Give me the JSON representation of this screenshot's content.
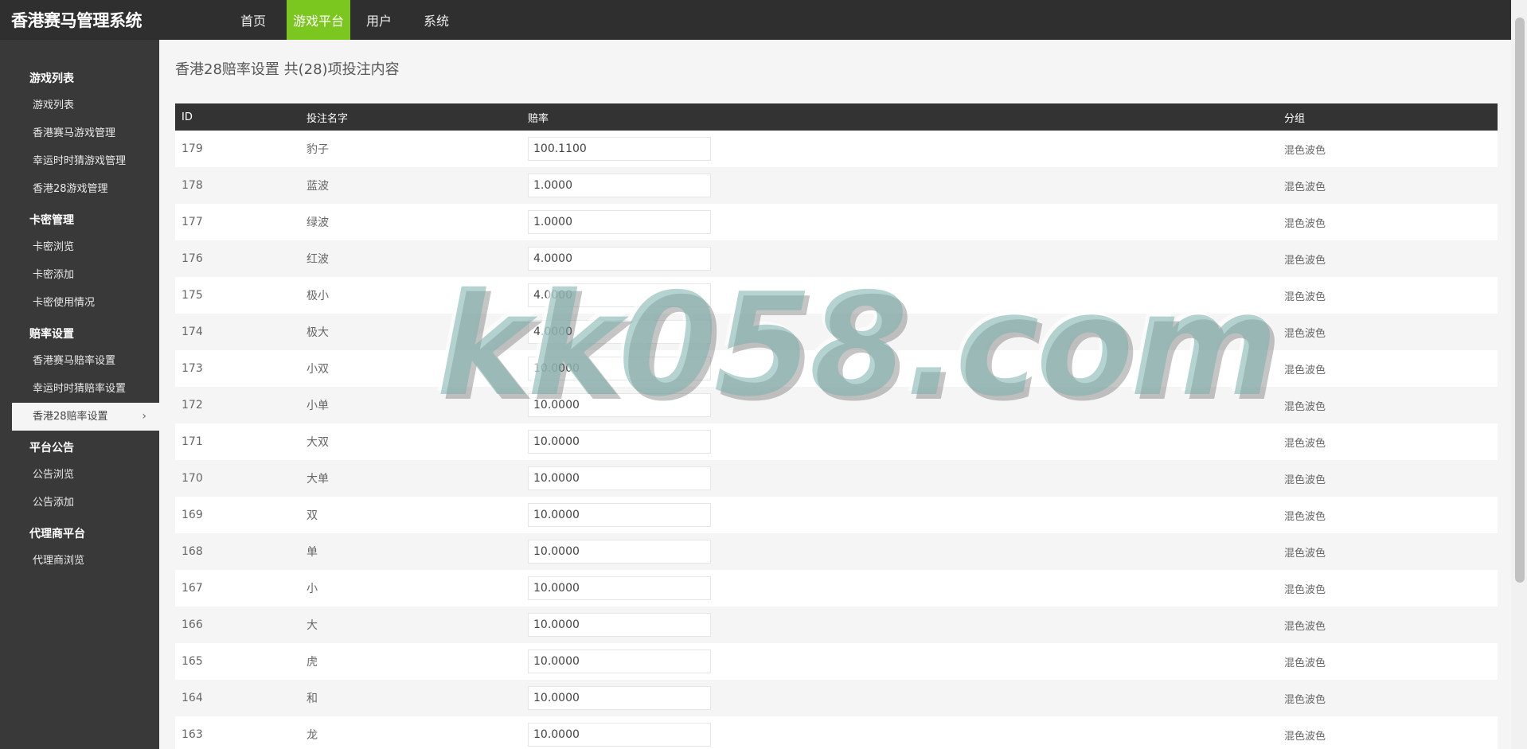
{
  "app": {
    "brand": "香港赛马管理系统"
  },
  "topnav": [
    {
      "label": "首页",
      "active": false
    },
    {
      "label": "游戏平台",
      "active": true
    },
    {
      "label": "用户",
      "active": false
    },
    {
      "label": "系统",
      "active": false
    }
  ],
  "sidebar": {
    "groups": [
      {
        "title": "游戏列表",
        "items": [
          "游戏列表",
          "香港赛马游戏管理",
          "幸运时时猜游戏管理",
          "香港28游戏管理"
        ]
      },
      {
        "title": "卡密管理",
        "items": [
          "卡密浏览",
          "卡密添加",
          "卡密使用情况"
        ]
      },
      {
        "title": "赔率设置",
        "items": [
          "香港赛马赔率设置",
          "幸运时时猜赔率设置",
          "香港28赔率设置"
        ]
      },
      {
        "title": "平台公告",
        "items": [
          "公告浏览",
          "公告添加"
        ]
      },
      {
        "title": "代理商平台",
        "items": [
          "代理商浏览"
        ]
      }
    ],
    "active_item": "香港28赔率设置"
  },
  "main": {
    "title": "香港28赔率设置 共(28)项投注内容",
    "columns": [
      "ID",
      "投注名字",
      "赔率",
      "分组"
    ],
    "rows": [
      {
        "id": "179",
        "name": "豹子",
        "odds": "100.1100",
        "group": "混色波色"
      },
      {
        "id": "178",
        "name": "蓝波",
        "odds": "1.0000",
        "group": "混色波色"
      },
      {
        "id": "177",
        "name": "绿波",
        "odds": "1.0000",
        "group": "混色波色"
      },
      {
        "id": "176",
        "name": "红波",
        "odds": "4.0000",
        "group": "混色波色"
      },
      {
        "id": "175",
        "name": "极小",
        "odds": "4.0000",
        "group": "混色波色"
      },
      {
        "id": "174",
        "name": "极大",
        "odds": "4.0000",
        "group": "混色波色"
      },
      {
        "id": "173",
        "name": "小双",
        "odds": "10.0000",
        "group": "混色波色"
      },
      {
        "id": "172",
        "name": "小单",
        "odds": "10.0000",
        "group": "混色波色"
      },
      {
        "id": "171",
        "name": "大双",
        "odds": "10.0000",
        "group": "混色波色"
      },
      {
        "id": "170",
        "name": "大单",
        "odds": "10.0000",
        "group": "混色波色"
      },
      {
        "id": "169",
        "name": "双",
        "odds": "10.0000",
        "group": "混色波色"
      },
      {
        "id": "168",
        "name": "单",
        "odds": "10.0000",
        "group": "混色波色"
      },
      {
        "id": "167",
        "name": "小",
        "odds": "10.0000",
        "group": "混色波色"
      },
      {
        "id": "166",
        "name": "大",
        "odds": "10.0000",
        "group": "混色波色"
      },
      {
        "id": "165",
        "name": "虎",
        "odds": "10.0000",
        "group": "混色波色"
      },
      {
        "id": "164",
        "name": "和",
        "odds": "10.0000",
        "group": "混色波色"
      },
      {
        "id": "163",
        "name": "龙",
        "odds": "10.0000",
        "group": "混色波色"
      }
    ]
  },
  "watermark": "kk058.com",
  "colors": {
    "topbar": "#2f2f2f",
    "sidebar": "#393939",
    "accent": "#7bc61f",
    "table_header": "#333333"
  }
}
